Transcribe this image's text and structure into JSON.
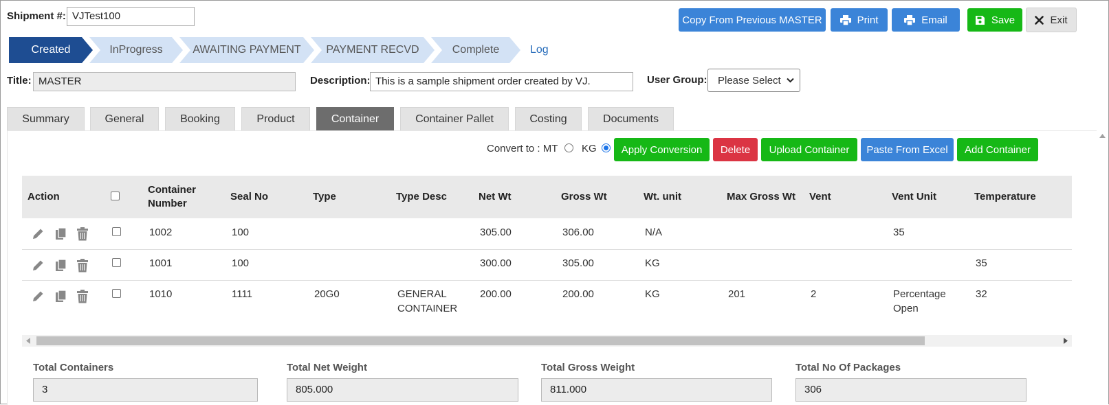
{
  "header": {
    "shipment_label": "Shipment #:",
    "shipment_value": "VJTest100",
    "buttons": {
      "copy": "Copy From Previous MASTER",
      "print": "Print",
      "email": "Email",
      "save": "Save",
      "exit": "Exit"
    }
  },
  "wizard": {
    "steps": [
      "Created",
      "InProgress",
      "AWAITING PAYMENT",
      "PAYMENT RECVD",
      "Complete"
    ],
    "active": "Created",
    "log_link": "Log"
  },
  "form": {
    "title_label": "Title:",
    "title_value": "MASTER",
    "description_label": "Description:",
    "description_value": "This is a sample shipment order created by VJ.",
    "user_group_label": "User Group:",
    "user_group_selected": "Please Select"
  },
  "tabs": [
    "Summary",
    "General",
    "Booking",
    "Product",
    "Container",
    "Container Pallet",
    "Costing",
    "Documents"
  ],
  "active_tab": "Container",
  "toolbar": {
    "convert_label": "Convert to : MT",
    "kg_label": "KG",
    "selected_unit": "KG",
    "apply": "Apply Conversion",
    "delete": "Delete",
    "upload": "Upload Container",
    "paste": "Paste From Excel",
    "add": "Add Container"
  },
  "table": {
    "columns": {
      "action": "Action",
      "container_number": "Container Number",
      "seal_no": "Seal No",
      "type": "Type",
      "type_desc": "Type Desc",
      "net_wt": "Net Wt",
      "gross_wt": "Gross Wt",
      "wt_unit": "Wt. unit",
      "max_gross_wt": "Max Gross Wt",
      "vent": "Vent",
      "vent_unit": "Vent Unit",
      "temperature": "Temperature"
    },
    "rows": [
      {
        "container_number": "1002",
        "seal_no": "100",
        "type": "",
        "type_desc": "",
        "net_wt": "305.00",
        "gross_wt": "306.00",
        "wt_unit": "N/A",
        "max_gross_wt": "",
        "vent": "",
        "vent_unit": "35",
        "temperature": ""
      },
      {
        "container_number": "1001",
        "seal_no": "100",
        "type": "",
        "type_desc": "",
        "net_wt": "300.00",
        "gross_wt": "305.00",
        "wt_unit": "KG",
        "max_gross_wt": "",
        "vent": "",
        "vent_unit": "",
        "temperature": "35"
      },
      {
        "container_number": "1010",
        "seal_no": "1111",
        "type": "20G0",
        "type_desc": "GENERAL CONTAINER",
        "net_wt": "200.00",
        "gross_wt": "200.00",
        "wt_unit": "KG",
        "max_gross_wt": "201",
        "vent": "2",
        "vent_unit": "Percentage Open",
        "temperature": "32"
      }
    ]
  },
  "totals": {
    "containers_label": "Total Containers",
    "containers_value": "3",
    "net_label": "Total Net Weight",
    "net_value": "805.000",
    "gross_label": "Total Gross Weight",
    "gross_value": "811.000",
    "packages_label": "Total No Of Packages",
    "packages_value": "306"
  },
  "colors": {
    "primary_blue": "#3b84d8",
    "success_green": "#16b816",
    "danger_red": "#db3443",
    "wizard_active": "#1e4d92",
    "wizard_inactive": "#d3e2f5",
    "tab_active": "#6d6d6d"
  },
  "icons": [
    "save-icon",
    "print-icon",
    "close-icon",
    "edit-icon",
    "copy-icon",
    "trash-icon"
  ]
}
